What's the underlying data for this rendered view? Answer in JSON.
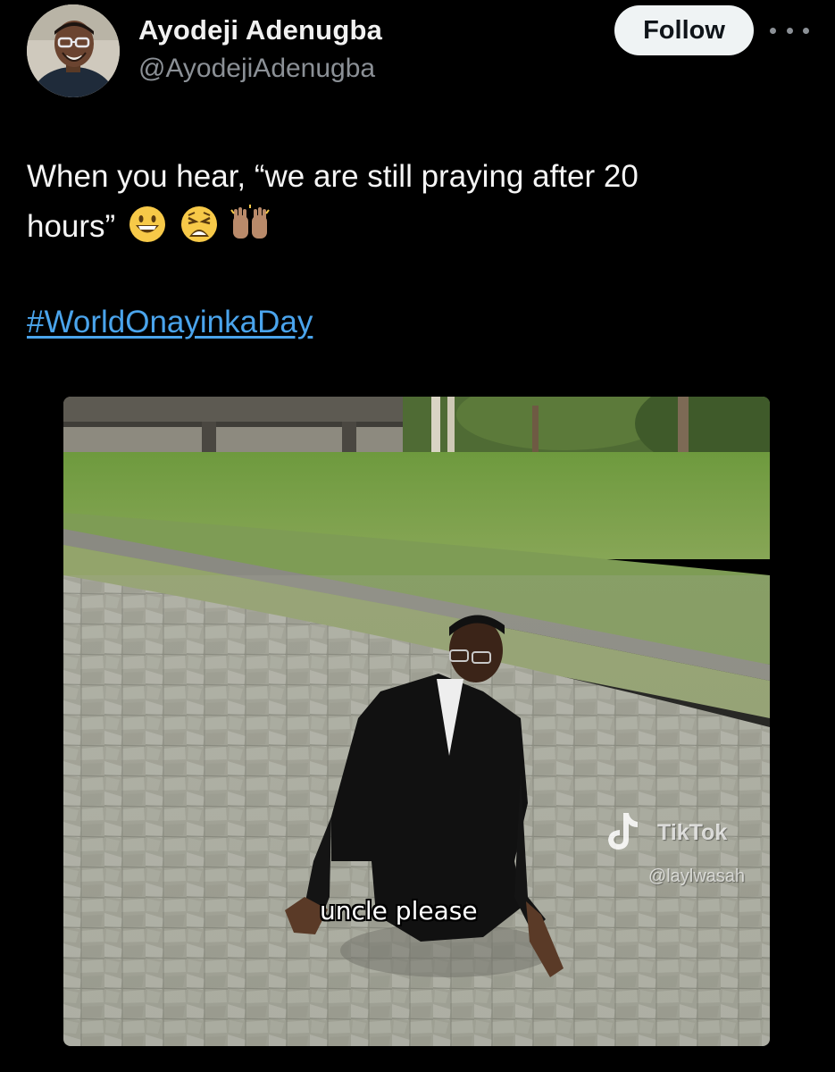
{
  "author": {
    "display_name": "Ayodeji Adenugba",
    "handle": "@AyodejiAdenugba"
  },
  "actions": {
    "follow_label": "Follow",
    "more_icon": "more-horizontal-icon"
  },
  "tweet": {
    "text_line1": "When you hear, “we are still praying after 20",
    "text_line2": "hours”",
    "emojis": [
      "grinning-face-icon",
      "weary-face-icon",
      "raised-hands-icon"
    ],
    "hashtag": "#WorldOnayinkaDay"
  },
  "media": {
    "caption": "uncle please",
    "watermark": {
      "brand": "TikTok",
      "handle": "@laylwasah"
    }
  },
  "colors": {
    "background": "#000000",
    "link": "#4aa4ec",
    "secondary_text": "#8b9096",
    "follow_button_bg": "#eff3f4"
  }
}
